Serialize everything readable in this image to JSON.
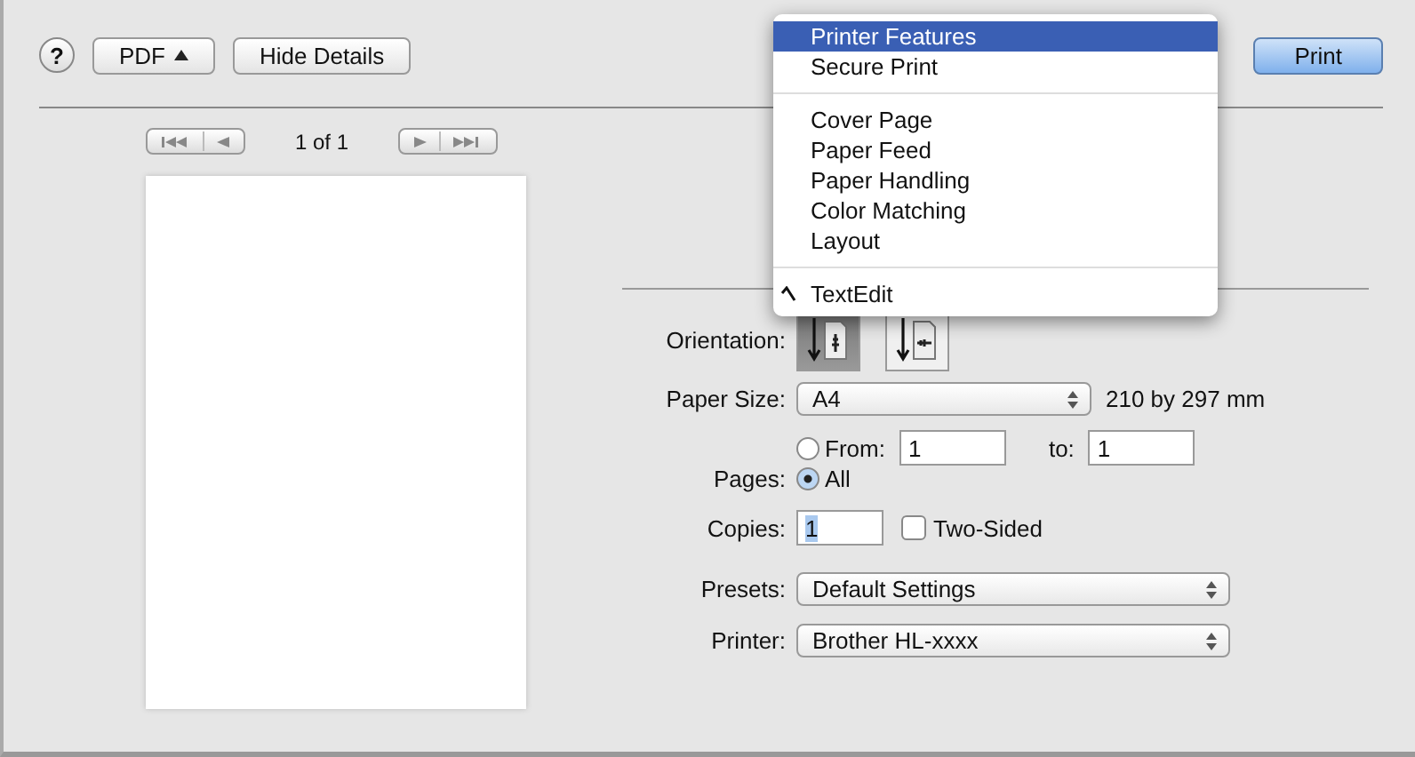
{
  "toolbar": {
    "help": "?",
    "pdf_button": "PDF",
    "hide_details_button": "Hide Details",
    "print_button": "Print"
  },
  "preview": {
    "page_counter": "1 of 1"
  },
  "orientation": {
    "label": "Orientation:",
    "options": [
      {
        "kind": "portrait",
        "selected": true
      },
      {
        "kind": "landscape",
        "selected": false
      }
    ]
  },
  "paper_size": {
    "label": "Paper Size:",
    "value": "A4",
    "dimensions": "210 by 297 mm"
  },
  "pages": {
    "label": "Pages:",
    "options": [
      {
        "label": "From:",
        "selected": false
      },
      {
        "label": "All",
        "selected": true
      }
    ],
    "from": "1",
    "to_label": "to:",
    "to": "1"
  },
  "copies": {
    "label": "Copies:",
    "value": "1",
    "two_sided": {
      "label": "Two-Sided",
      "checked": false
    }
  },
  "presets": {
    "label": "Presets:",
    "value": "Default Settings"
  },
  "printer": {
    "label": "Printer:",
    "value": "Brother HL-xxxx"
  },
  "section_menu": {
    "groups": [
      [
        {
          "label": "Printer Features",
          "checked": false,
          "selected": true
        },
        {
          "label": "Secure Print",
          "checked": false,
          "selected": false
        }
      ],
      [
        {
          "label": "Cover Page",
          "checked": false,
          "selected": false
        },
        {
          "label": "Paper Feed",
          "checked": false,
          "selected": false
        },
        {
          "label": "Paper Handling",
          "checked": false,
          "selected": false
        },
        {
          "label": "Color Matching",
          "checked": false,
          "selected": false
        },
        {
          "label": "Layout",
          "checked": false,
          "selected": false
        }
      ],
      [
        {
          "label": "TextEdit",
          "checked": true,
          "selected": false
        }
      ]
    ]
  }
}
